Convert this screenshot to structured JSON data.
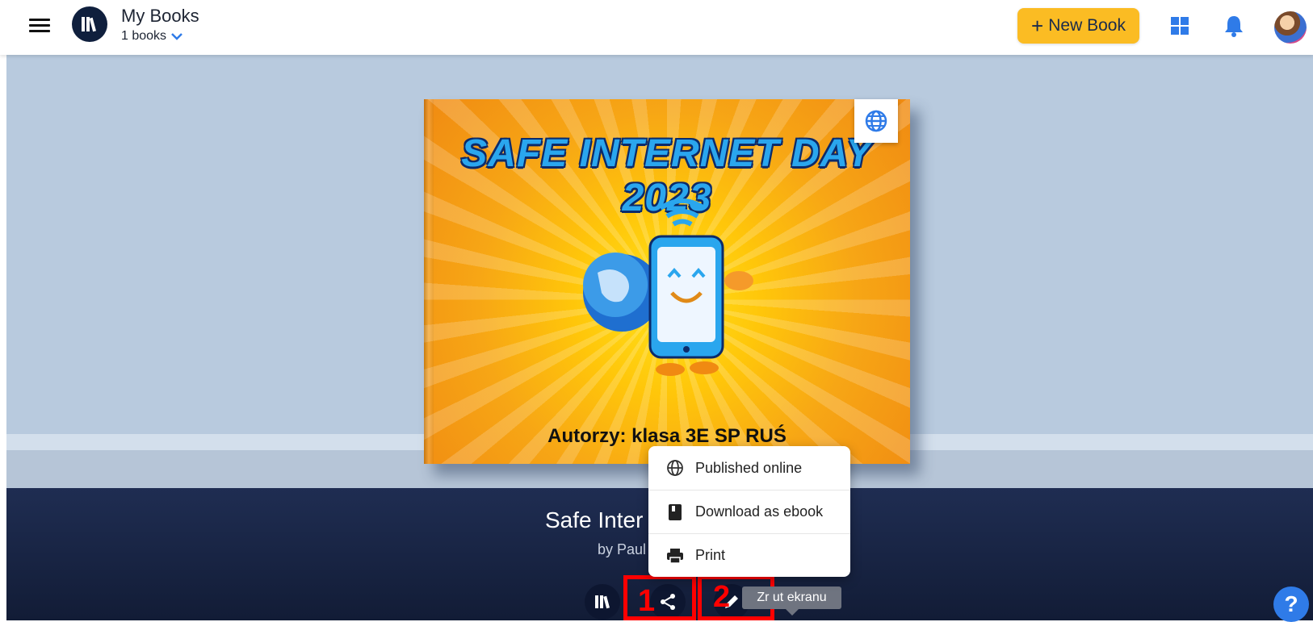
{
  "header": {
    "title": "My Books",
    "books_count": "1 books",
    "new_book_label": "New Book",
    "new_book_plus": "+",
    "accent_color": "#fbbc23"
  },
  "book": {
    "cover_title": "SAFE INTERNET DAY 2023",
    "cover_authors": "Autorzy: klasa 3E SP RUŚ",
    "title_visible": "Safe Inter",
    "author_visible": "by Paul"
  },
  "share_menu": {
    "items": [
      {
        "label": "Published online",
        "icon": "globe-icon"
      },
      {
        "label": "Download as ebook",
        "icon": "book-icon"
      },
      {
        "label": "Print",
        "icon": "printer-icon"
      }
    ]
  },
  "annotations": {
    "marker_1": "1",
    "marker_2": "2",
    "highlight_color": "#ff0000"
  },
  "tooltip": {
    "text": "Zr  ut ekranu"
  },
  "help": {
    "label": "?"
  },
  "colors": {
    "stage_bg": "#b8cade",
    "panel_bg": "#1f2d52",
    "help_blue": "#2f7be8"
  }
}
